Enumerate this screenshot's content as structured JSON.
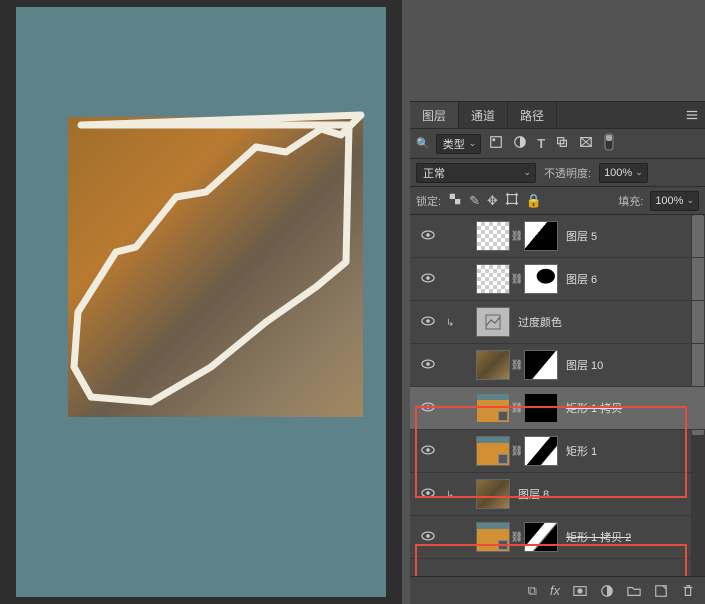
{
  "tabs": {
    "layers": "图层",
    "channels": "通道",
    "paths": "路径"
  },
  "filter": {
    "search_icon": "🔍",
    "type": "类型"
  },
  "blend": {
    "mode": "正常",
    "opacity_label": "不透明度:",
    "opacity_value": "100%"
  },
  "lock": {
    "label": "锁定:",
    "fill_label": "填充:",
    "fill_value": "100%"
  },
  "layers": [
    {
      "name": "图层 5",
      "strike": false,
      "indent": 1,
      "thumb": "trans",
      "mask": "m5",
      "eye": true
    },
    {
      "name": "图层 6",
      "strike": false,
      "indent": 1,
      "thumb": "trans",
      "mask": "m6",
      "eye": true
    },
    {
      "name": "过度颜色",
      "strike": false,
      "indent": 1,
      "thumb": "hue",
      "mask": null,
      "eye": true,
      "clip": true
    },
    {
      "name": "图层 10",
      "strike": false,
      "indent": 1,
      "thumb": "img",
      "mask": "m10",
      "eye": true
    },
    {
      "name": "矩形 1 拷贝",
      "strike": true,
      "indent": 1,
      "thumb": "orange",
      "mask": "black",
      "eye": true,
      "shape": true,
      "selected": true
    },
    {
      "name": "矩形 1",
      "strike": false,
      "indent": 1,
      "thumb": "orange",
      "mask": "mr",
      "eye": true,
      "shape": true
    },
    {
      "name": "图层 8",
      "strike": false,
      "indent": 1,
      "thumb": "img",
      "mask": null,
      "eye": true,
      "clip": true
    },
    {
      "name": "矩形 1 拷贝 2",
      "strike": true,
      "indent": 1,
      "thumb": "orange",
      "mask": "mr2",
      "eye": true,
      "shape": true,
      "maskblack": true
    }
  ]
}
